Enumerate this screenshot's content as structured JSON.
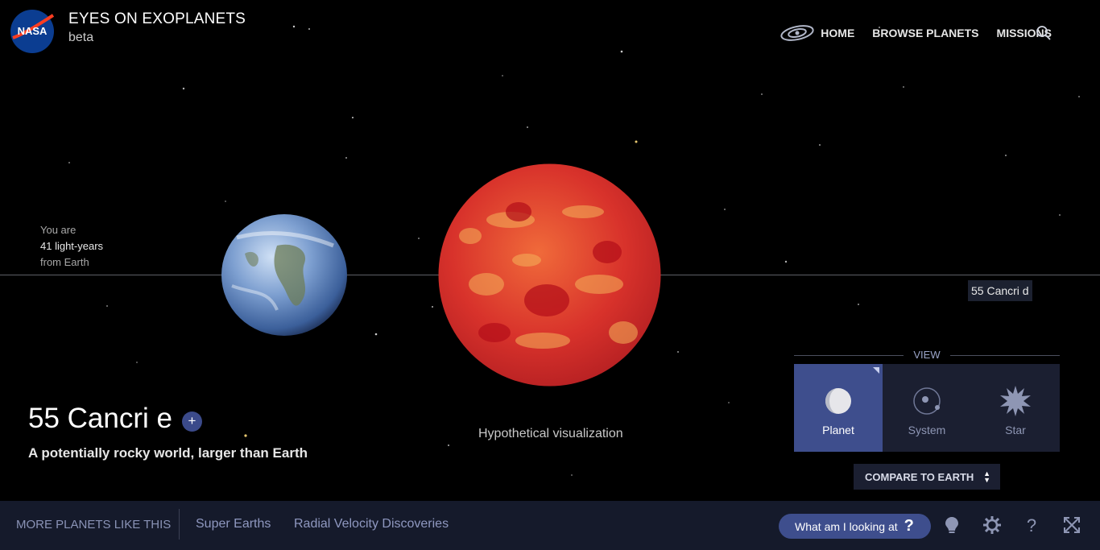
{
  "header": {
    "logo_text": "NASA",
    "title": "EYES ON EXOPLANETS",
    "subtitle": "beta",
    "nav": [
      "HOME",
      "BROWSE PLANETS",
      "MISSIONS"
    ],
    "icons": {
      "home": "galaxy-icon",
      "search": "search-icon"
    }
  },
  "scene": {
    "distance_prefix": "You are",
    "distance_value": "41 light-years",
    "distance_suffix": "from Earth",
    "neighbor_label": "55 Cancri d",
    "hypothetical": "Hypothetical visualization"
  },
  "planet": {
    "name": "55 Cancri e",
    "add_symbol": "+",
    "description": "A potentially rocky world, larger than Earth"
  },
  "view": {
    "label": "VIEW",
    "options": [
      "Planet",
      "System",
      "Star"
    ],
    "selected": "Planet"
  },
  "compare": {
    "label": "COMPARE TO EARTH"
  },
  "bottom_bar": {
    "more_label": "MORE PLANETS LIKE THIS",
    "tags": [
      "Super Earths",
      "Radial Velocity Discoveries"
    ],
    "what_label": "What am I looking at",
    "what_symbol": "?",
    "tools": [
      "lightbulb-icon",
      "settings-icon",
      "help-icon",
      "fullscreen-icon"
    ]
  },
  "colors": {
    "background": "#000000",
    "accent": "#3e4e8d",
    "panel": "#1b1f31",
    "bottom_bar": "#151a2b"
  }
}
